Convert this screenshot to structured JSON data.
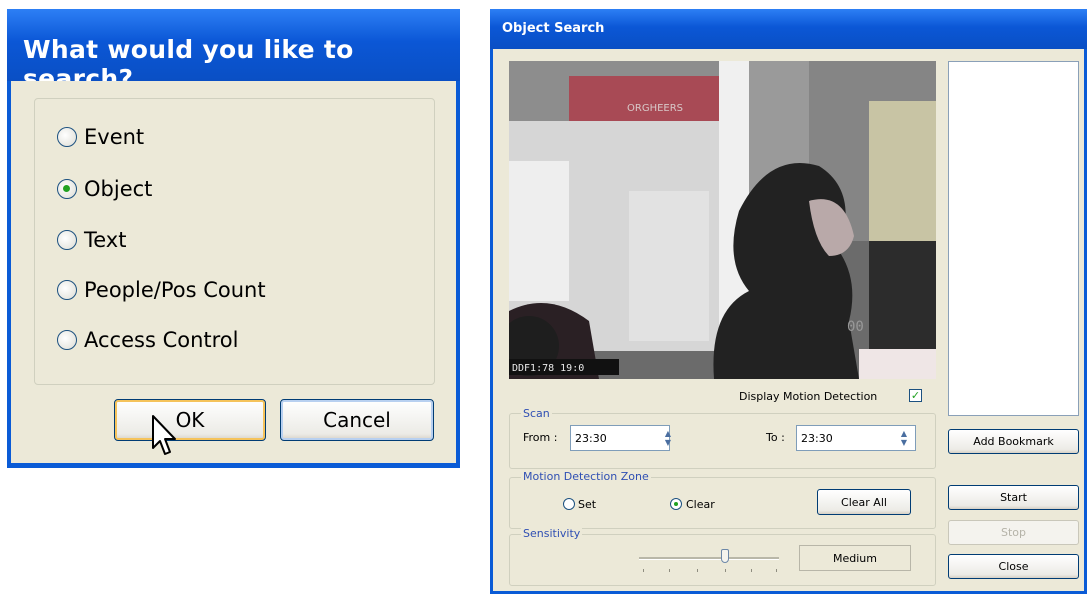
{
  "search_dialog": {
    "title": "What would you like to search?",
    "options": [
      {
        "label": "Event",
        "selected": false
      },
      {
        "label": "Object",
        "selected": true
      },
      {
        "label": "Text",
        "selected": false
      },
      {
        "label": "People/Pos Count",
        "selected": false
      },
      {
        "label": "Access Control",
        "selected": false
      }
    ],
    "ok_label": "OK",
    "cancel_label": "Cancel"
  },
  "object_search": {
    "title": "Object Search",
    "video": {
      "overlay_text": "DDF1:78 19:0",
      "sign_text": "ORGHEERS",
      "camera_tag": "00"
    },
    "display_motion_label": "Display Motion Detection",
    "display_motion_checked": true,
    "scan": {
      "label": "Scan",
      "from_label": "From :",
      "from_value": "23:30",
      "to_label": "To :",
      "to_value": "23:30"
    },
    "zone": {
      "label": "Motion Detection Zone",
      "set_label": "Set",
      "clear_label": "Clear",
      "clear_all_label": "Clear All",
      "selected": "Clear"
    },
    "sensitivity": {
      "label": "Sensitivity",
      "value_label": "Medium",
      "level": 0.5
    },
    "buttons": {
      "add_bookmark": "Add Bookmark",
      "start": "Start",
      "stop": "Stop",
      "close": "Close"
    },
    "colors": {
      "titlebar": "#0b57d6",
      "client": "#ece9d8",
      "radio_dot": "#21a121",
      "group_label": "#2f4fb3"
    }
  }
}
